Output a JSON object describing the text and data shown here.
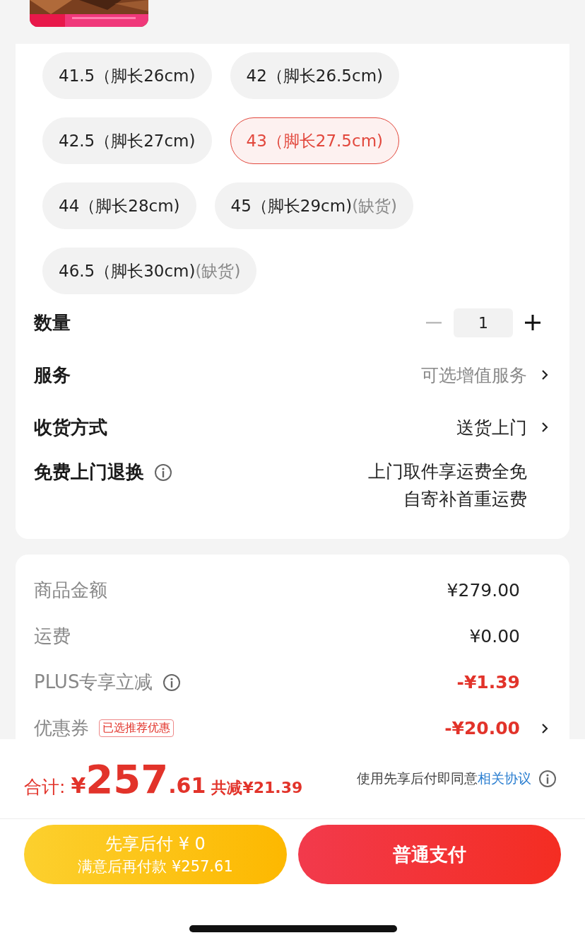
{
  "sizes": [
    {
      "label": "41.5（脚长26cm)",
      "selected": false
    },
    {
      "label": "42（脚长26.5cm)",
      "selected": false
    },
    {
      "label": "42.5（脚长27cm)",
      "selected": false
    },
    {
      "label": "43（脚长27.5cm)",
      "selected": true
    },
    {
      "label": "44（脚长28cm)",
      "selected": false
    },
    {
      "label": "45（脚长29cm)",
      "note": "(缺货)",
      "selected": false
    },
    {
      "label": "46.5（脚长30cm)",
      "note": "(缺货)",
      "selected": false
    }
  ],
  "quantity": {
    "label": "数量",
    "value": "1",
    "minus_disabled": true
  },
  "options": [
    {
      "kind": "link",
      "label": "服务",
      "value": "可选增值服务",
      "muted": true
    },
    {
      "kind": "link",
      "label": "收货方式",
      "value": "送货上门",
      "muted": false
    },
    {
      "kind": "info",
      "label": "免费上门退换",
      "lines": [
        "上门取件享运费全免",
        "自寄补首重运费"
      ]
    }
  ],
  "summary": [
    {
      "label": "商品金额",
      "value": "¥279.00",
      "discount": false
    },
    {
      "label": "运费",
      "value": "¥0.00",
      "discount": false
    },
    {
      "label": "PLUS专享立减",
      "value": "-¥1.39",
      "discount": true,
      "info": true
    },
    {
      "label": "优惠券",
      "tag": "已选推荐优惠",
      "value": "-¥20.00",
      "discount": true,
      "arrow": true
    }
  ],
  "footer": {
    "total_label": "合计:",
    "currency": "¥",
    "amount": "257",
    "decimals": ".61",
    "saved": "共减¥21.39",
    "agreement": "使用先享后付即同意",
    "agreement_link": "相关协议",
    "pay_later": {
      "title": "先享后付 ¥ 0",
      "subtitle": "满意后再付款 ¥257.61"
    },
    "pay": "普通支付"
  }
}
